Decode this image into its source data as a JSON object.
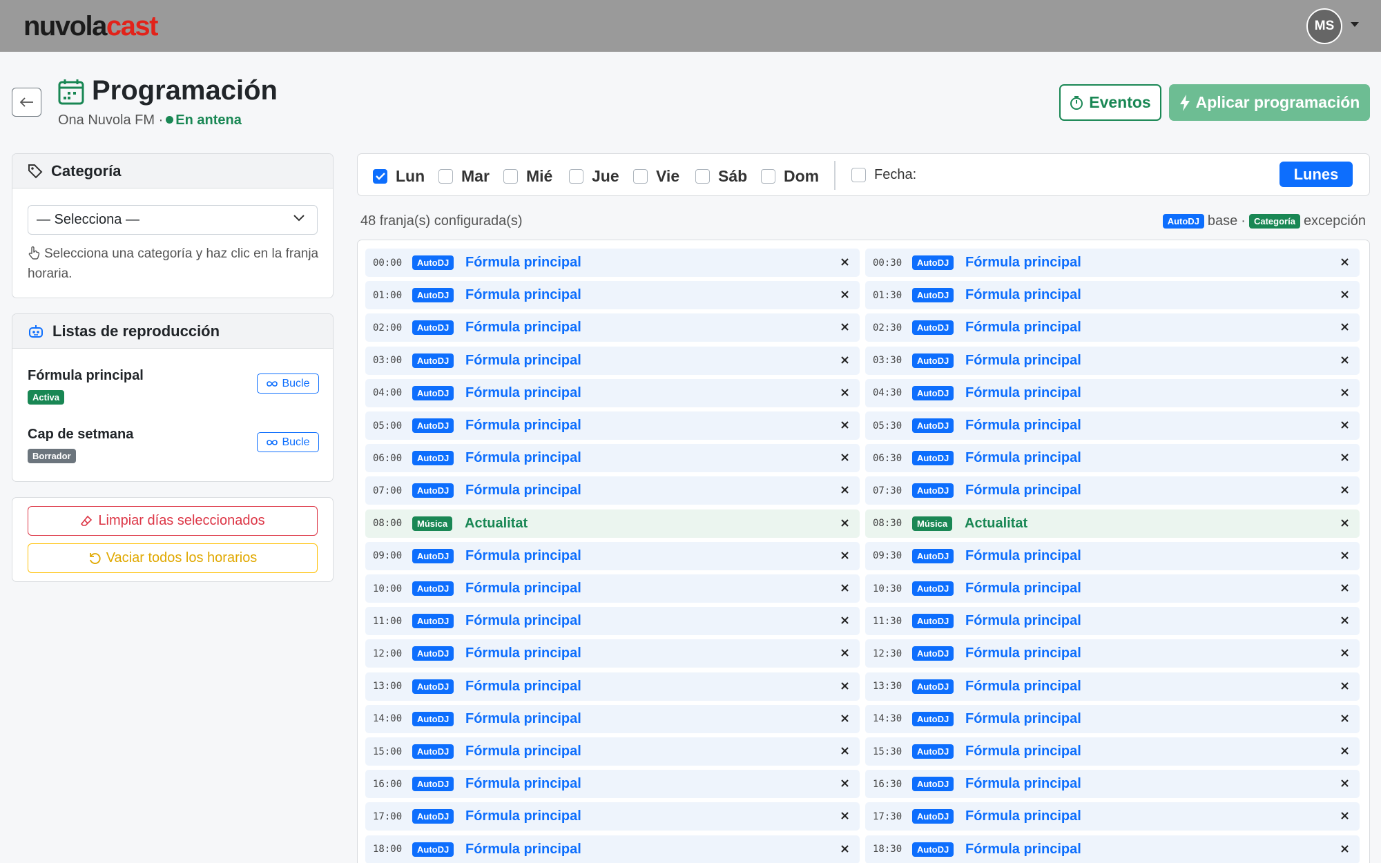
{
  "app": {
    "logo_part1": "nuvola",
    "logo_part2": "cast",
    "user_initials": "MS"
  },
  "header": {
    "title": "Programación",
    "station": "Ona Nuvola FM",
    "separator": "·",
    "status": "En antena",
    "events_label": "Eventos",
    "apply_label": "Aplicar programación"
  },
  "category_card": {
    "title": "Categoría",
    "select_value": "— Selecciona —",
    "hint": "Selecciona una categoría y haz clic en la franja horaria."
  },
  "playlists_card": {
    "title": "Listas de reproducción",
    "items": [
      {
        "name": "Fórmula principal",
        "status": "Activa",
        "status_color": "#198754",
        "loop_label": "Bucle"
      },
      {
        "name": "Cap de setmana",
        "status": "Borrador",
        "status_color": "#6c757d",
        "loop_label": "Bucle"
      }
    ]
  },
  "actions": {
    "clear_days": "Limpiar días seleccionados",
    "empty_all": "Vaciar todos los horarios"
  },
  "days": [
    {
      "label": "Lun",
      "checked": true
    },
    {
      "label": "Mar",
      "checked": false
    },
    {
      "label": "Mié",
      "checked": false
    },
    {
      "label": "Jue",
      "checked": false
    },
    {
      "label": "Vie",
      "checked": false
    },
    {
      "label": "Sáb",
      "checked": false
    },
    {
      "label": "Dom",
      "checked": false
    }
  ],
  "date_filter": {
    "label": "Fecha:",
    "checked": false
  },
  "current_day_button": "Lunes",
  "summary": {
    "count_text": "48 franja(s) configurada(s)",
    "legend_base_tag": "AutoDJ",
    "legend_base_text": "base",
    "legend_sep": "·",
    "legend_exc_tag": "Categoría",
    "legend_exc_text": "excepción"
  },
  "slots": [
    {
      "time": "00:00",
      "tag": "AutoDJ",
      "name": "Fórmula principal",
      "kind": "autodj"
    },
    {
      "time": "00:30",
      "tag": "AutoDJ",
      "name": "Fórmula principal",
      "kind": "autodj"
    },
    {
      "time": "01:00",
      "tag": "AutoDJ",
      "name": "Fórmula principal",
      "kind": "autodj"
    },
    {
      "time": "01:30",
      "tag": "AutoDJ",
      "name": "Fórmula principal",
      "kind": "autodj"
    },
    {
      "time": "02:00",
      "tag": "AutoDJ",
      "name": "Fórmula principal",
      "kind": "autodj"
    },
    {
      "time": "02:30",
      "tag": "AutoDJ",
      "name": "Fórmula principal",
      "kind": "autodj"
    },
    {
      "time": "03:00",
      "tag": "AutoDJ",
      "name": "Fórmula principal",
      "kind": "autodj"
    },
    {
      "time": "03:30",
      "tag": "AutoDJ",
      "name": "Fórmula principal",
      "kind": "autodj"
    },
    {
      "time": "04:00",
      "tag": "AutoDJ",
      "name": "Fórmula principal",
      "kind": "autodj"
    },
    {
      "time": "04:30",
      "tag": "AutoDJ",
      "name": "Fórmula principal",
      "kind": "autodj"
    },
    {
      "time": "05:00",
      "tag": "AutoDJ",
      "name": "Fórmula principal",
      "kind": "autodj"
    },
    {
      "time": "05:30",
      "tag": "AutoDJ",
      "name": "Fórmula principal",
      "kind": "autodj"
    },
    {
      "time": "06:00",
      "tag": "AutoDJ",
      "name": "Fórmula principal",
      "kind": "autodj"
    },
    {
      "time": "06:30",
      "tag": "AutoDJ",
      "name": "Fórmula principal",
      "kind": "autodj"
    },
    {
      "time": "07:00",
      "tag": "AutoDJ",
      "name": "Fórmula principal",
      "kind": "autodj"
    },
    {
      "time": "07:30",
      "tag": "AutoDJ",
      "name": "Fórmula principal",
      "kind": "autodj"
    },
    {
      "time": "08:00",
      "tag": "Música",
      "name": "Actualitat",
      "kind": "category"
    },
    {
      "time": "08:30",
      "tag": "Música",
      "name": "Actualitat",
      "kind": "category"
    },
    {
      "time": "09:00",
      "tag": "AutoDJ",
      "name": "Fórmula principal",
      "kind": "autodj"
    },
    {
      "time": "09:30",
      "tag": "AutoDJ",
      "name": "Fórmula principal",
      "kind": "autodj"
    },
    {
      "time": "10:00",
      "tag": "AutoDJ",
      "name": "Fórmula principal",
      "kind": "autodj"
    },
    {
      "time": "10:30",
      "tag": "AutoDJ",
      "name": "Fórmula principal",
      "kind": "autodj"
    },
    {
      "time": "11:00",
      "tag": "AutoDJ",
      "name": "Fórmula principal",
      "kind": "autodj"
    },
    {
      "time": "11:30",
      "tag": "AutoDJ",
      "name": "Fórmula principal",
      "kind": "autodj"
    },
    {
      "time": "12:00",
      "tag": "AutoDJ",
      "name": "Fórmula principal",
      "kind": "autodj"
    },
    {
      "time": "12:30",
      "tag": "AutoDJ",
      "name": "Fórmula principal",
      "kind": "autodj"
    },
    {
      "time": "13:00",
      "tag": "AutoDJ",
      "name": "Fórmula principal",
      "kind": "autodj"
    },
    {
      "time": "13:30",
      "tag": "AutoDJ",
      "name": "Fórmula principal",
      "kind": "autodj"
    },
    {
      "time": "14:00",
      "tag": "AutoDJ",
      "name": "Fórmula principal",
      "kind": "autodj"
    },
    {
      "time": "14:30",
      "tag": "AutoDJ",
      "name": "Fórmula principal",
      "kind": "autodj"
    },
    {
      "time": "15:00",
      "tag": "AutoDJ",
      "name": "Fórmula principal",
      "kind": "autodj"
    },
    {
      "time": "15:30",
      "tag": "AutoDJ",
      "name": "Fórmula principal",
      "kind": "autodj"
    },
    {
      "time": "16:00",
      "tag": "AutoDJ",
      "name": "Fórmula principal",
      "kind": "autodj"
    },
    {
      "time": "16:30",
      "tag": "AutoDJ",
      "name": "Fórmula principal",
      "kind": "autodj"
    },
    {
      "time": "17:00",
      "tag": "AutoDJ",
      "name": "Fórmula principal",
      "kind": "autodj"
    },
    {
      "time": "17:30",
      "tag": "AutoDJ",
      "name": "Fórmula principal",
      "kind": "autodj"
    },
    {
      "time": "18:00",
      "tag": "AutoDJ",
      "name": "Fórmula principal",
      "kind": "autodj"
    },
    {
      "time": "18:30",
      "tag": "AutoDJ",
      "name": "Fórmula principal",
      "kind": "autodj"
    }
  ],
  "colors": {
    "primary": "#0d6efd",
    "success": "#198754",
    "danger": "#dc3545",
    "warning": "#ffc107",
    "topbar": "#9a9a9a"
  }
}
